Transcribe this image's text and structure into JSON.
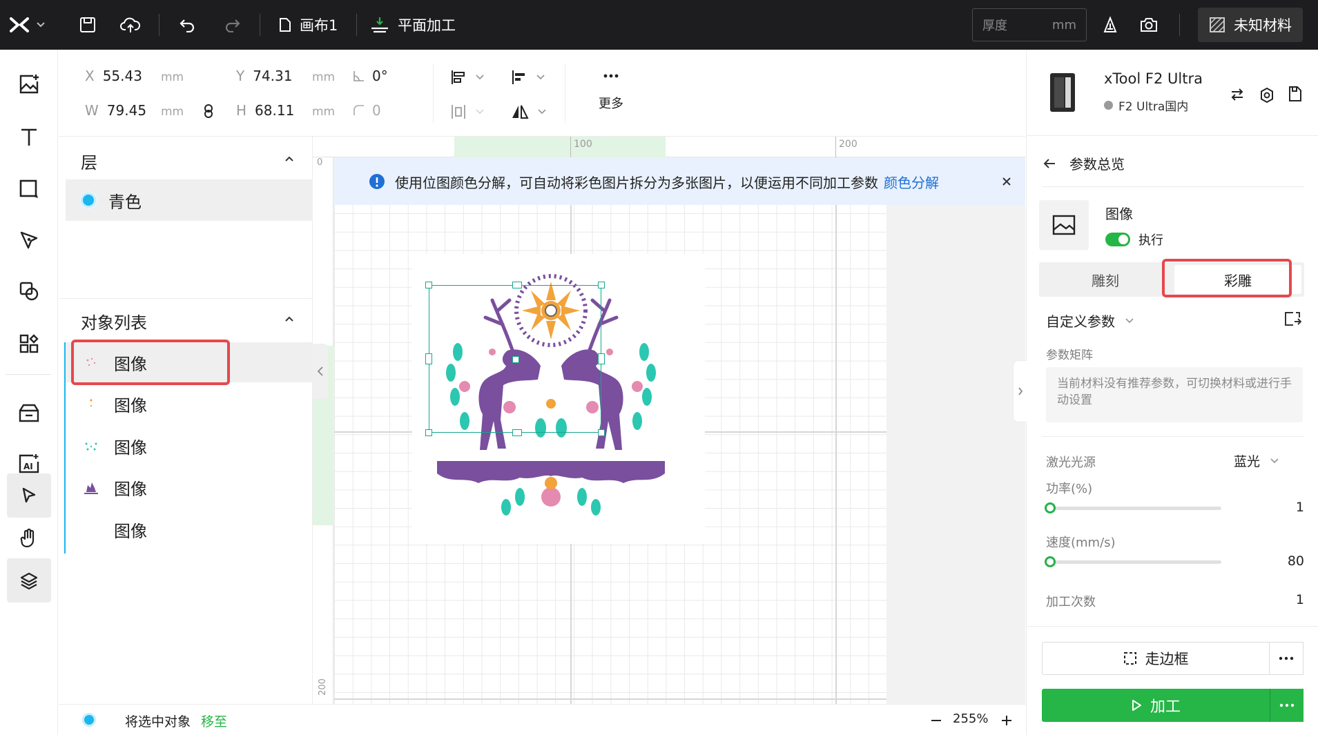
{
  "topbar": {
    "canvas_name": "画布1",
    "mode_label": "平面加工",
    "thickness_placeholder": "厚度",
    "thickness_unit": "mm",
    "material_label": "未知材料"
  },
  "props": {
    "x_key": "X",
    "x_value": "55.43",
    "x_unit": "mm",
    "y_key": "Y",
    "y_value": "74.31",
    "y_unit": "mm",
    "w_key": "W",
    "w_value": "79.45",
    "w_unit": "mm",
    "h_key": "H",
    "h_value": "68.11",
    "h_unit": "mm",
    "rotation": "0°",
    "corner_radius": "0",
    "more_label": "更多"
  },
  "layers": {
    "title": "层",
    "items": [
      {
        "label": "青色",
        "color": "#1ab6ee"
      }
    ]
  },
  "objects": {
    "title": "对象列表",
    "items": [
      {
        "label": "图像"
      },
      {
        "label": "图像"
      },
      {
        "label": "图像"
      },
      {
        "label": "图像"
      },
      {
        "label": "图像"
      }
    ]
  },
  "canvas": {
    "ruler_top_labels": [
      "100",
      "200"
    ],
    "ruler_left_labels": [
      "0",
      "200"
    ],
    "notice_text": "使用位图颜色分解，可自动将彩色图片拆分为多张图片，以便运用不同加工参数",
    "notice_link": "颜色分解"
  },
  "status": {
    "move_text": "将选中对象",
    "move_link": "移至",
    "zoom": "255%"
  },
  "device": {
    "name": "xTool F2 Ultra",
    "region": "F2 Ultra国内"
  },
  "params": {
    "back_label": "参数总览",
    "object_type": "图像",
    "execute_label": "执行",
    "tabs": [
      "雕刻",
      "彩雕"
    ],
    "active_tab": "彩雕",
    "preset_label": "自定义参数",
    "matrix_label": "参数矩阵",
    "matrix_note": "当前材料没有推荐参数，可切换材料或进行手动设置",
    "laser_label": "激光光源",
    "laser_value": "蓝光",
    "power_label": "功率(%)",
    "power_value": "1",
    "speed_label": "速度(mm/s)",
    "speed_value": "80",
    "passes_label": "加工次数",
    "passes_value": "1",
    "frame_label": "走边框",
    "process_label": "加工"
  },
  "colors": {
    "accent_green": "#26b547",
    "highlight_red": "#e5484d",
    "link_blue": "#1f6fd6",
    "layer_cyan": "#1ab6ee"
  }
}
